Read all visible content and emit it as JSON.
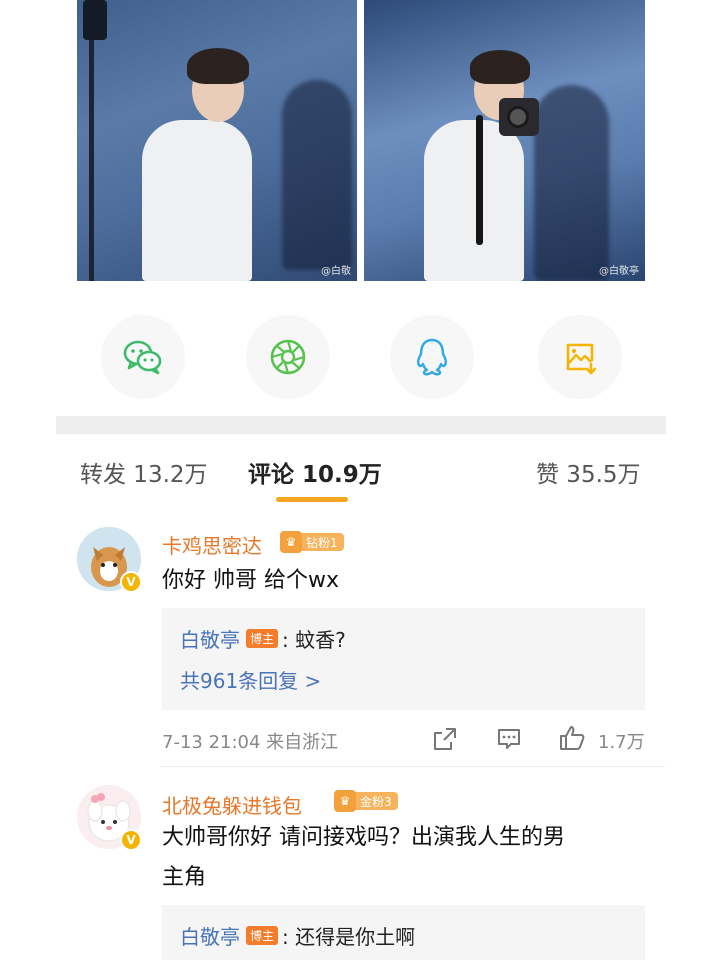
{
  "photos": [
    {
      "watermark": "@白敬"
    },
    {
      "watermark": "@白敬亭"
    }
  ],
  "share_row": [
    {
      "icon": "wechat-icon",
      "color": "#3dbb6b"
    },
    {
      "icon": "moments-icon",
      "color": "#57c24e"
    },
    {
      "icon": "qq-icon",
      "color": "#2fa8e8"
    },
    {
      "icon": "save-image-icon",
      "color": "#f5b400"
    }
  ],
  "tabs": {
    "repost": "转发 13.2万",
    "comments": "评论 10.9万",
    "likes": "赞 35.5万",
    "accent": "#f6a623"
  },
  "comments": [
    {
      "username": "卡鸡思密达",
      "fan_badge": "钻粉1",
      "text": "你好 帅哥 给个wx",
      "reply": {
        "author": "白敬亭",
        "badge": "博主",
        "text": ": 蚊香?"
      },
      "reply_count": "共961条回复 >",
      "meta": "7-13 21:04 来自浙江",
      "likes": "1.7万"
    },
    {
      "username": "北极兔躲进钱包",
      "fan_badge": "金粉3",
      "text_line1": "大帅哥你好 请问接戏吗？出演我人生的男",
      "text_line2": "主角",
      "reply": {
        "author": "白敬亭",
        "badge": "博主",
        "text": ": 还得是你土啊"
      }
    }
  ]
}
